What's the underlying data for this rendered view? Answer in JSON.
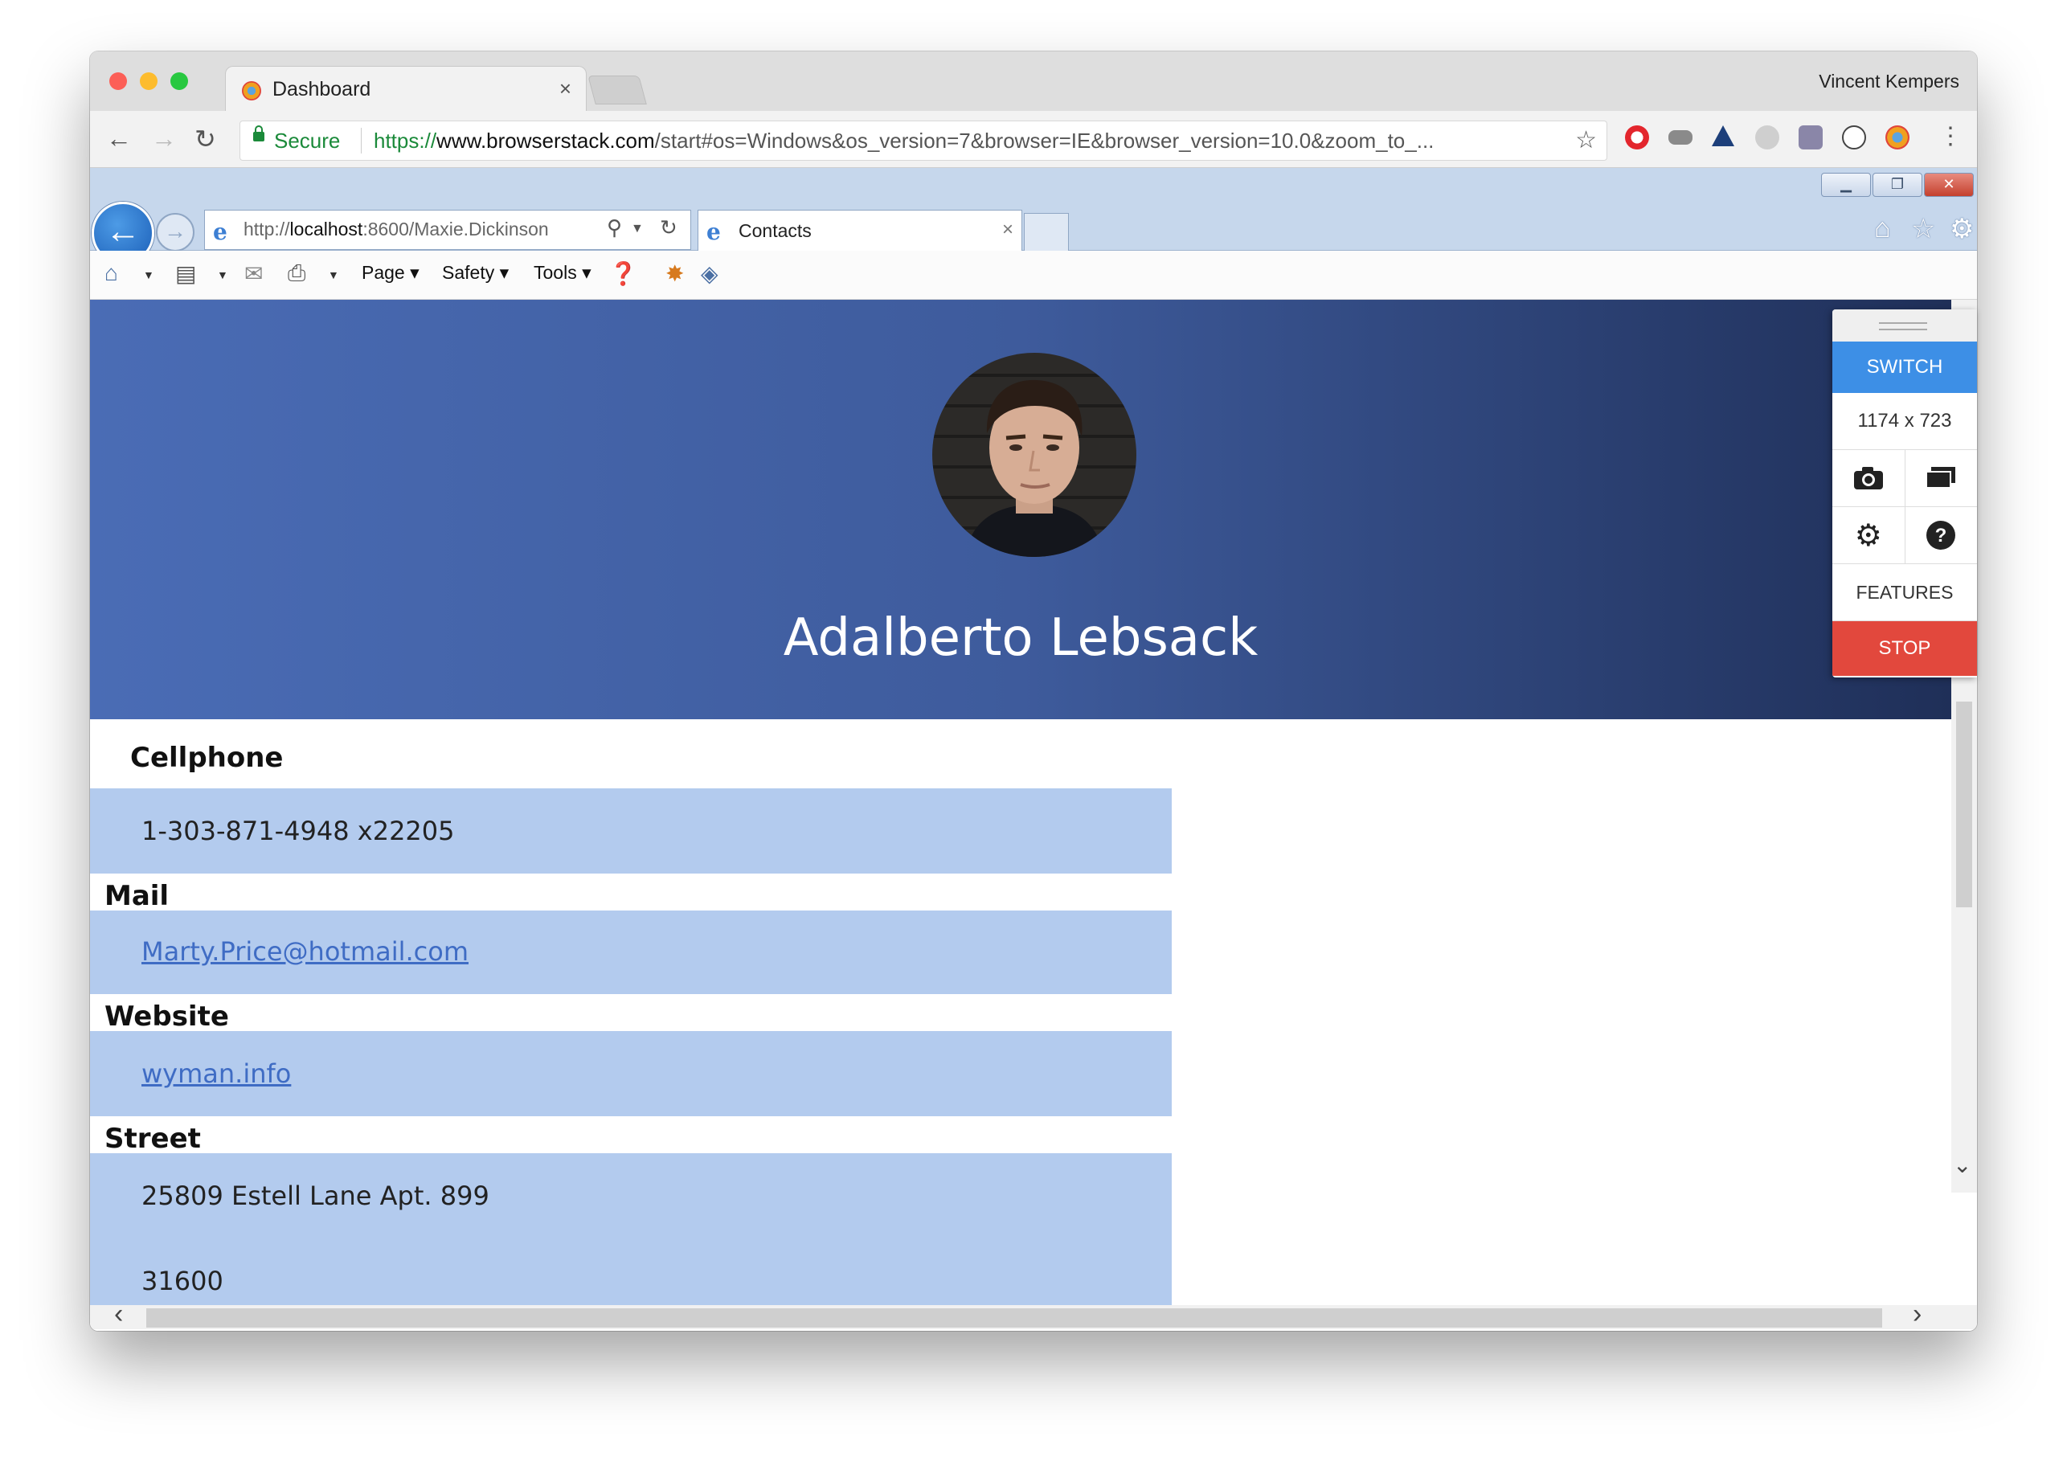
{
  "chrome": {
    "tab_title": "Dashboard",
    "tab_close": "×",
    "user_name": "Vincent Kempers",
    "secure_label": "Secure",
    "url_scheme": "https://",
    "url_domain": "www.browserstack.com",
    "url_rest": "/start#os=Windows&os_version=7&browser=IE&browser_version=10.0&zoom_to_..."
  },
  "ie": {
    "address_prefix": "http://",
    "address_host": "localhost",
    "address_rest": ":8600/Maxie.Dickinson",
    "tab_title": "Contacts",
    "tab_close": "×",
    "commands": [
      "Page ▾",
      "Safety ▾",
      "Tools ▾"
    ]
  },
  "profile": {
    "name": "Adalberto Lebsack",
    "fields": [
      {
        "label": "Cellphone",
        "value": "1-303-871-4948 x22205"
      },
      {
        "label": "Mail",
        "value": "Marty.Price@hotmail.com"
      },
      {
        "label": "Website",
        "value": "wyman.info"
      },
      {
        "label": "Street",
        "value": "25809 Estell Lane Apt. 899"
      }
    ],
    "zip": "31600"
  },
  "browserstack": {
    "switch": "SWITCH",
    "resolution": "1174 x 723",
    "features": "FEATURES",
    "stop": "STOP"
  },
  "colors": {
    "hero_start": "#4a6cb5",
    "hero_end": "#1f2f58",
    "field_bg": "#b3cbee",
    "switch_bg": "#3d8fe6",
    "stop_bg": "#e2483d"
  },
  "icons": [
    "back-arrow-icon",
    "forward-arrow-icon",
    "reload-icon",
    "lock-icon",
    "star-icon",
    "menu-icon",
    "home-icon",
    "favorites-icon",
    "settings-gear-icon",
    "camera-icon",
    "screens-icon",
    "gear-icon",
    "help-icon"
  ]
}
